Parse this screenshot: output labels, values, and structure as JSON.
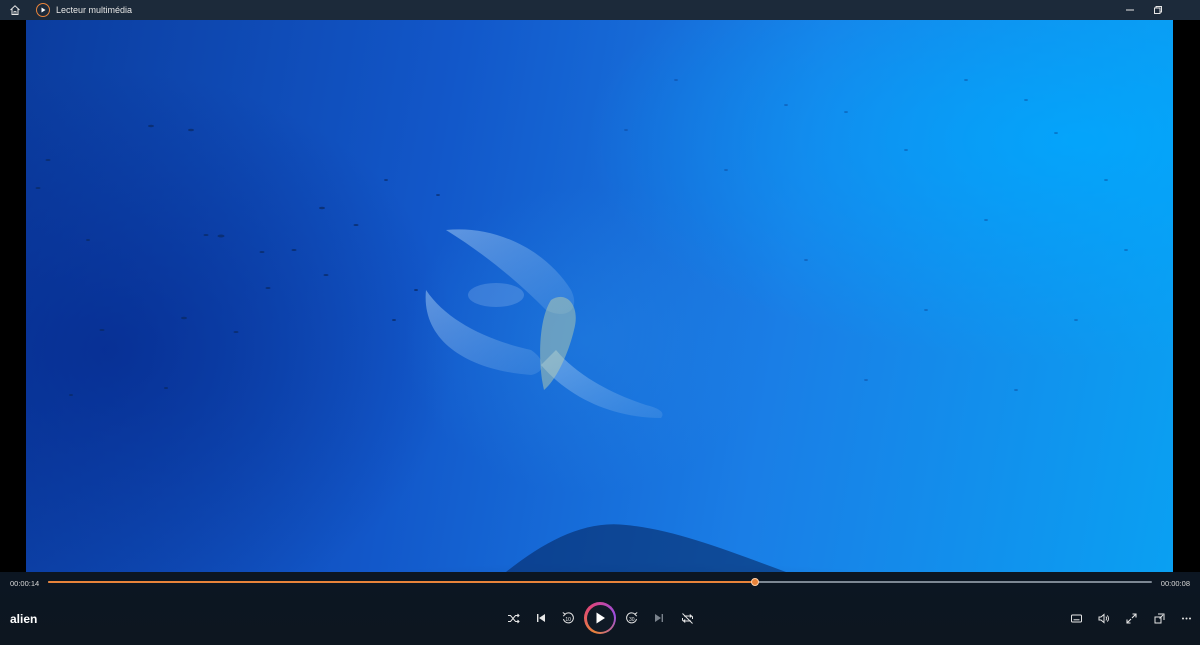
{
  "window": {
    "title": "Lecteur multimédia",
    "accent": "#e8833a",
    "icons": [
      "home-icon",
      "app-logo-icon",
      "minimize-icon",
      "restore-icon"
    ]
  },
  "player": {
    "media_title": "alien",
    "elapsed": "00:00:14",
    "remaining": "00:00:08",
    "progress": 0.64
  },
  "controls": {
    "center": [
      "shuffle-icon",
      "previous-icon",
      "rewind-10-icon",
      "play-icon",
      "forward-30-icon",
      "next-icon",
      "repeat-off-icon"
    ],
    "right": [
      "subtitles-icon",
      "volume-icon",
      "fullscreen-icon",
      "miniplayer-icon",
      "more-icon"
    ],
    "rewind_label": "10",
    "forward_label": "30"
  }
}
